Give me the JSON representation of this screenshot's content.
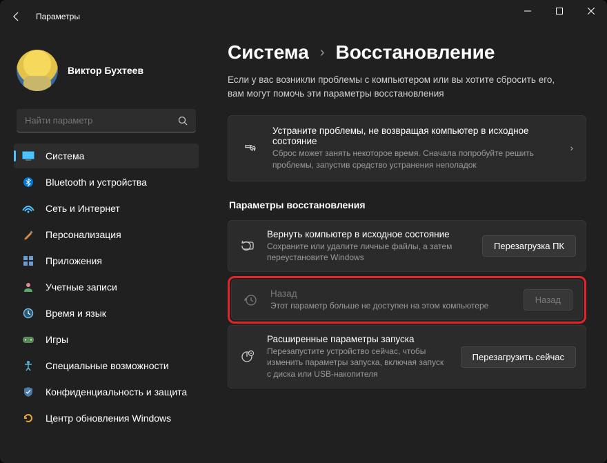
{
  "window": {
    "title": "Параметры"
  },
  "profile": {
    "name": "Виктор Бухтеев",
    "subtitle": ""
  },
  "search": {
    "placeholder": "Найти параметр"
  },
  "nav": [
    {
      "label": "Система",
      "icon": "system"
    },
    {
      "label": "Bluetooth и устройства",
      "icon": "bluetooth"
    },
    {
      "label": "Сеть и Интернет",
      "icon": "network"
    },
    {
      "label": "Персонализация",
      "icon": "personalization"
    },
    {
      "label": "Приложения",
      "icon": "apps"
    },
    {
      "label": "Учетные записи",
      "icon": "accounts"
    },
    {
      "label": "Время и язык",
      "icon": "time"
    },
    {
      "label": "Игры",
      "icon": "gaming"
    },
    {
      "label": "Специальные возможности",
      "icon": "accessibility"
    },
    {
      "label": "Конфиденциальность и защита",
      "icon": "privacy"
    },
    {
      "label": "Центр обновления Windows",
      "icon": "update"
    }
  ],
  "breadcrumb": {
    "parent": "Система",
    "current": "Восстановление"
  },
  "intro": "Если у вас возникли проблемы с компьютером или вы хотите сбросить его, вам могут помочь эти параметры восстановления",
  "fixcard": {
    "title": "Устраните проблемы, не возвращая компьютер в исходное состояние",
    "desc": "Сброс может занять некоторое время. Сначала попробуйте решить проблемы, запустив средство устранения неполадок"
  },
  "section_title": "Параметры восстановления",
  "options": {
    "reset": {
      "title": "Вернуть компьютер в исходное состояние",
      "desc": "Сохраните или удалите личные файлы, а затем переустановите Windows",
      "button": "Перезагрузка ПК"
    },
    "goback": {
      "title": "Назад",
      "desc": "Этот параметр больше не доступен на этом компьютере",
      "button": "Назад"
    },
    "advanced": {
      "title": "Расширенные параметры запуска",
      "desc": "Перезапустите устройство сейчас, чтобы изменить параметры запуска, включая запуск с диска или USB-накопителя",
      "button": "Перезагрузить сейчас"
    }
  }
}
